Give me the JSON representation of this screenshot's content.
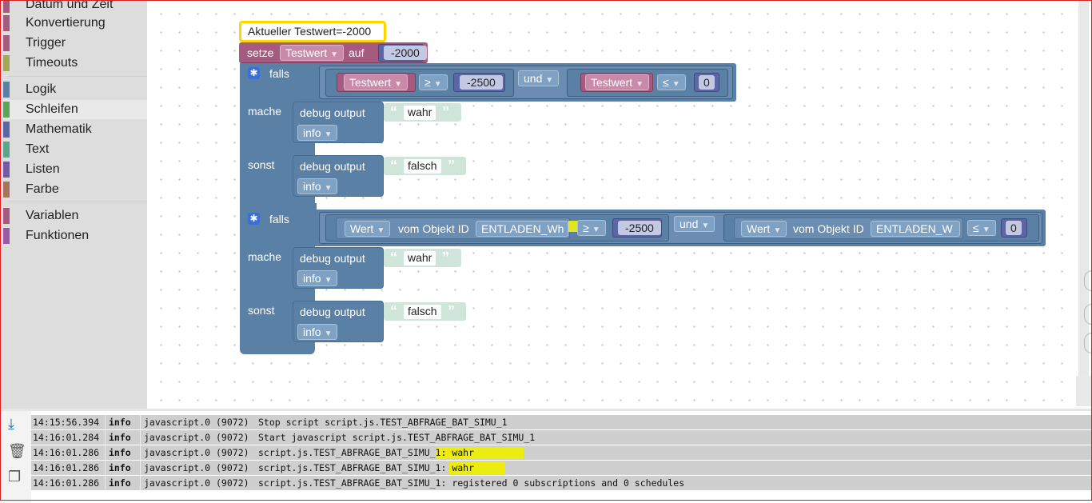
{
  "toolbox": {
    "items": [
      {
        "label": "Datum und Zeit",
        "color": "#a55b80"
      },
      {
        "label": "Konvertierung",
        "color": "#a55b80"
      },
      {
        "label": "Trigger",
        "color": "#a55b80"
      },
      {
        "label": "Timeouts",
        "color": "#a5a55b"
      },
      {
        "label": "Logik",
        "color": "#5b80a5"
      },
      {
        "label": "Schleifen",
        "color": "#5ba55b"
      },
      {
        "label": "Mathematik",
        "color": "#5b67a5"
      },
      {
        "label": "Text",
        "color": "#5ba58c"
      },
      {
        "label": "Listen",
        "color": "#745ba5"
      },
      {
        "label": "Farbe",
        "color": "#a5745b"
      },
      {
        "label": "Variablen",
        "color": "#a55b80"
      },
      {
        "label": "Funktionen",
        "color": "#995ba5"
      }
    ]
  },
  "blocks": {
    "comment": "Aktueller Testwert=-2000",
    "set": {
      "keyword": "setze",
      "var": "Testwert",
      "to": "auf",
      "value": "-2000"
    },
    "if1": {
      "falls": "falls",
      "left_var": "Testwert",
      "op1": "≥",
      "val1": "-2500",
      "and": "und",
      "right_var": "Testwert",
      "op2": "≤",
      "val2": "0",
      "mache": "mache",
      "sonst": "sonst",
      "debug1": "debug output",
      "level1": "info",
      "str1": "wahr",
      "debug2": "debug output",
      "level2": "info",
      "str2": "falsch"
    },
    "if2": {
      "falls": "falls",
      "left_attr": "Wert",
      "of_obj": "vom Objekt ID",
      "left_id": "ENTLADEN_Wh",
      "op1": "≥",
      "val1": "-2500",
      "and": "und",
      "right_attr": "Wert",
      "of_obj2": "vom Objekt ID",
      "right_id": "ENTLADEN_W",
      "op2": "≤",
      "val2": "0",
      "mache": "mache",
      "sonst": "sonst",
      "debug1": "debug output",
      "level1": "info",
      "str1": "wahr",
      "debug2": "debug output",
      "level2": "info",
      "str2": "falsch"
    }
  },
  "log": {
    "rows": [
      {
        "time": "14:15:56.394",
        "level": "info",
        "source": "javascript.0 (9072)",
        "message": "Stop script script.js.TEST_ABFRAGE_BAT_SIMU_1"
      },
      {
        "time": "14:16:01.284",
        "level": "info",
        "source": "javascript.0 (9072)",
        "message": "Start javascript script.js.TEST_ABFRAGE_BAT_SIMU_1"
      },
      {
        "time": "14:16:01.286",
        "level": "info",
        "source": "javascript.0 (9072)",
        "message": "script.js.TEST_ABFRAGE_BAT_SIMU_1: wahr"
      },
      {
        "time": "14:16:01.286",
        "level": "info",
        "source": "javascript.0 (9072)",
        "message": "script.js.TEST_ABFRAGE_BAT_SIMU_1: wahr"
      },
      {
        "time": "14:16:01.286",
        "level": "info",
        "source": "javascript.0 (9072)",
        "message": "script.js.TEST_ABFRAGE_BAT_SIMU_1: registered 0 subscriptions and 0 schedules"
      }
    ]
  },
  "colors": {
    "logic": "#5b80a5",
    "variable": "#a55b80",
    "math": "#5b67a5",
    "text": "#cfe5d9",
    "highlight": "#e3e61a"
  }
}
